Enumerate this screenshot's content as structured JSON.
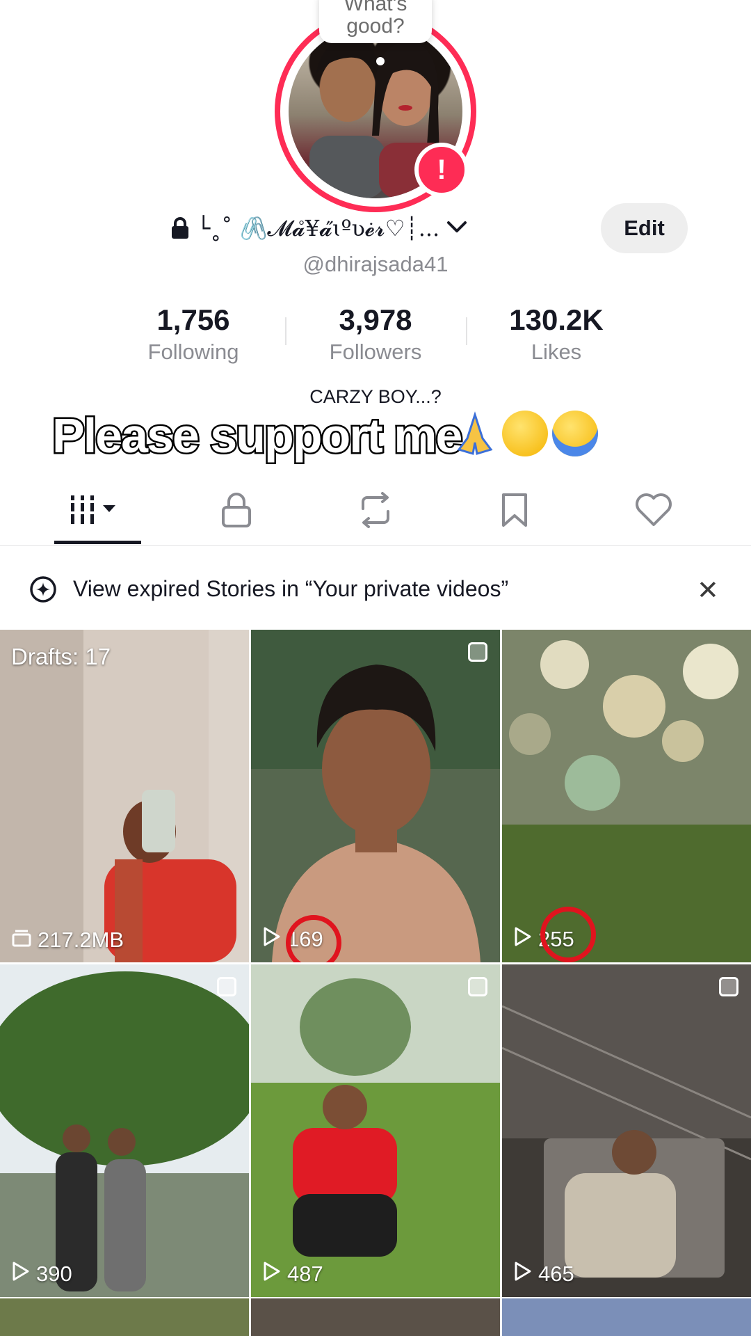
{
  "profile": {
    "note": "What's good?",
    "display_name": "└˳˚ 🖇️𝓜𝓪̊¥𝓪̋ɩºʋ𝓮̇𝓻♡┊...",
    "username": "@dhirajsada41",
    "edit_label": "Edit"
  },
  "stats": [
    {
      "value": "1,756",
      "label": "Following"
    },
    {
      "value": "3,978",
      "label": "Followers"
    },
    {
      "value": "130.2K",
      "label": "Likes"
    }
  ],
  "bio": {
    "line1": "CARZY BOY...?",
    "line2": "Please support me"
  },
  "tabs": {
    "active": "videos",
    "items": [
      "videos-grid-icon",
      "lock-icon",
      "repost-icon",
      "bookmark-icon",
      "heart-icon"
    ]
  },
  "stories_banner": {
    "text": "View expired Stories in “Your private videos”"
  },
  "grid": {
    "drafts_label": "Drafts: 17",
    "drafts_size": "217.2MB",
    "views": [
      "169",
      "255",
      "390",
      "487",
      "465"
    ]
  },
  "colors": {
    "accent": "#fe2c55",
    "text": "#161823",
    "muted": "#8a8b91"
  }
}
